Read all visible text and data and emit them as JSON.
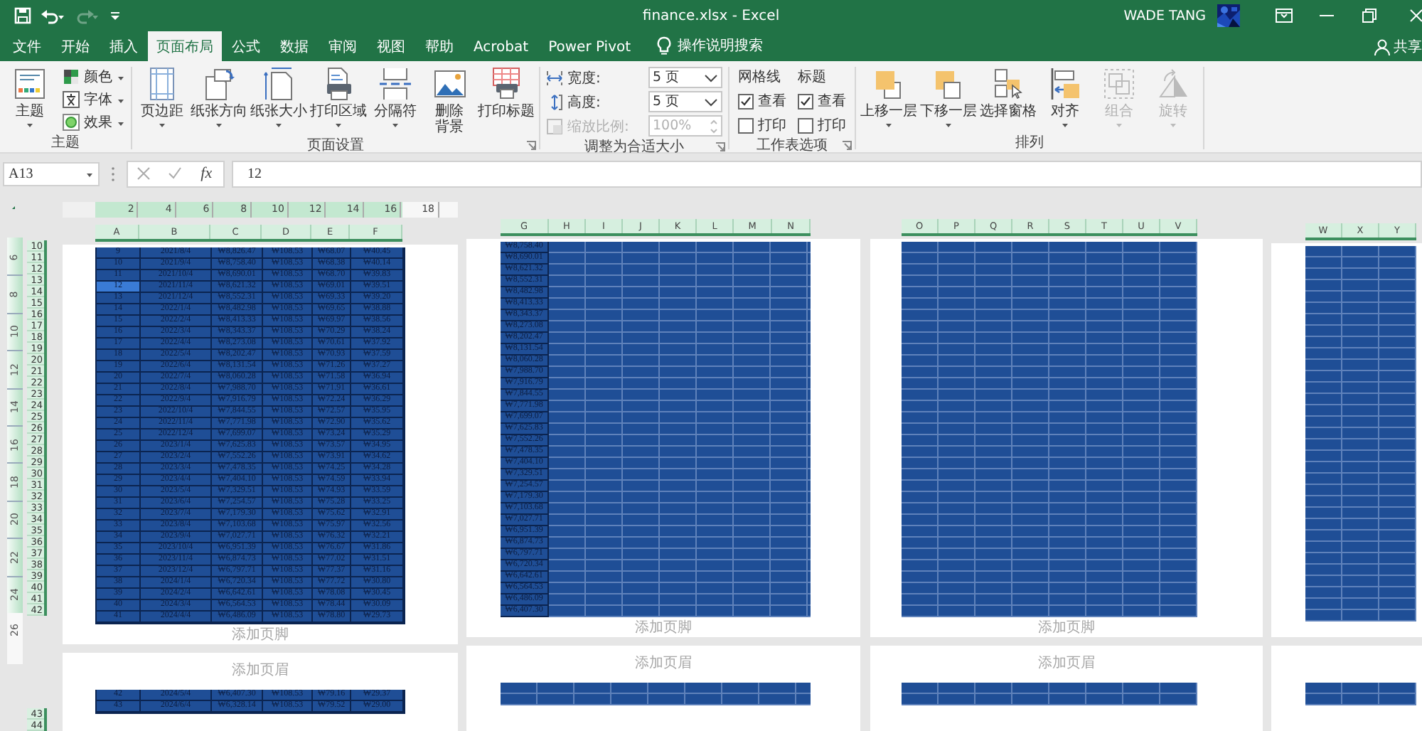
{
  "title_bar": {
    "title": "finance.xlsx  -  Excel",
    "user": "WADE TANG"
  },
  "ribbon_tabs": [
    {
      "label": "文件",
      "selected": false
    },
    {
      "label": "开始",
      "selected": false
    },
    {
      "label": "插入",
      "selected": false
    },
    {
      "label": "页面布局",
      "selected": true
    },
    {
      "label": "公式",
      "selected": false
    },
    {
      "label": "数据",
      "selected": false
    },
    {
      "label": "审阅",
      "selected": false
    },
    {
      "label": "视图",
      "selected": false
    },
    {
      "label": "帮助",
      "selected": false
    },
    {
      "label": "Acrobat",
      "selected": false
    },
    {
      "label": "Power Pivot",
      "selected": false
    }
  ],
  "tell_me": "操作说明搜索",
  "share": "共享",
  "ribbon_groups": [
    {
      "label": "主题",
      "launcher": false,
      "items": [
        {
          "kind": "big",
          "label": "主题",
          "menu": true
        },
        {
          "kind": "small",
          "label": "颜色",
          "menu": true
        },
        {
          "kind": "small",
          "label": "字体",
          "menu": true
        },
        {
          "kind": "small",
          "label": "效果",
          "menu": true
        }
      ]
    },
    {
      "label": "页面设置",
      "launcher": true,
      "items": [
        {
          "kind": "big",
          "label": "页边距",
          "menu": true
        },
        {
          "kind": "big",
          "label": "纸张方向",
          "menu": true
        },
        {
          "kind": "big",
          "label": "纸张大小",
          "menu": true
        },
        {
          "kind": "big",
          "label": "打印区域",
          "menu": true
        },
        {
          "kind": "big",
          "label": "分隔符",
          "menu": true
        },
        {
          "kind": "big",
          "lines": [
            "删除",
            "背景"
          ],
          "menu": false
        },
        {
          "kind": "big",
          "label": "打印标题",
          "menu": false
        }
      ]
    },
    {
      "label": "调整为合适大小",
      "launcher": true,
      "items": [
        {
          "kind": "dropdown",
          "label": "宽度:",
          "value": "5 页",
          "disabled": false
        },
        {
          "kind": "dropdown",
          "label": "高度:",
          "value": "5 页",
          "disabled": false
        },
        {
          "kind": "spinner",
          "label": "缩放比例:",
          "value": "100%",
          "disabled": true
        }
      ]
    },
    {
      "label": "工作表选项",
      "launcher": true,
      "items": [
        {
          "kind": "options",
          "label": "网格线",
          "options": [
            {
              "label": "查看",
              "checked": true
            },
            {
              "label": "打印",
              "checked": false
            }
          ]
        },
        {
          "kind": "options",
          "label": "标题",
          "options": [
            {
              "label": "查看",
              "checked": true
            },
            {
              "label": "打印",
              "checked": false
            }
          ]
        }
      ]
    },
    {
      "label": "排列",
      "launcher": false,
      "items": [
        {
          "kind": "big",
          "label": "上移一层",
          "menu": true,
          "disabled": false
        },
        {
          "kind": "big",
          "label": "下移一层",
          "menu": true,
          "disabled": false
        },
        {
          "kind": "big",
          "label": "选择窗格",
          "menu": false,
          "disabled": false
        },
        {
          "kind": "big",
          "label": "对齐",
          "menu": true,
          "disabled": false
        },
        {
          "kind": "big",
          "label": "组合",
          "menu": true,
          "disabled": true
        },
        {
          "kind": "big",
          "label": "旋转",
          "menu": true,
          "disabled": true
        }
      ]
    }
  ],
  "formula_bar": {
    "name_box": "A13",
    "function_button": "fx",
    "formula": "12"
  },
  "sheet_view": {
    "ruler_ticks": [
      "2",
      "4",
      "6",
      "8",
      "10",
      "12",
      "14",
      "16",
      "18"
    ],
    "vertical_ruler_ticks": [
      "6",
      "8",
      "10",
      "12",
      "14",
      "16",
      "18",
      "20",
      "22",
      "24"
    ],
    "vertical_ruler_page_end": "26",
    "row_headers": [
      "10",
      "11",
      "12",
      "13",
      "14",
      "15",
      "16",
      "17",
      "18",
      "19",
      "20",
      "21",
      "22",
      "23",
      "24",
      "25",
      "26",
      "27",
      "28",
      "29",
      "30",
      "31",
      "32",
      "33",
      "34",
      "35",
      "36",
      "37",
      "38",
      "39",
      "40",
      "41",
      "42"
    ],
    "pages": [
      {
        "columns": [
          "A",
          "B",
          "C",
          "D",
          "E",
          "F"
        ],
        "footer": "添加页脚",
        "rows": [
          {
            "cells": [
              "9",
              "2021/8/4",
              "₩8,826.47",
              "₩108.53",
              "₩68.07",
              "₩40.45"
            ],
            "selected": false
          },
          {
            "cells": [
              "10",
              "2021/9/4",
              "₩8,758.40",
              "₩108.53",
              "₩68.38",
              "₩40.14"
            ],
            "selected": false
          },
          {
            "cells": [
              "11",
              "2021/10/4",
              "₩8,690.01",
              "₩108.53",
              "₩68.70",
              "₩39.83"
            ],
            "selected": false
          },
          {
            "cells": [
              "12",
              "2021/11/4",
              "₩8,621.32",
              "₩108.53",
              "₩69.01",
              "₩39.51"
            ],
            "selected": true
          },
          {
            "cells": [
              "13",
              "2021/12/4",
              "₩8,552.31",
              "₩108.53",
              "₩69.33",
              "₩39.20"
            ],
            "selected": false
          },
          {
            "cells": [
              "14",
              "2022/1/4",
              "₩8,482.98",
              "₩108.53",
              "₩69.65",
              "₩38.88"
            ],
            "selected": false
          },
          {
            "cells": [
              "15",
              "2022/2/4",
              "₩8,413.33",
              "₩108.53",
              "₩69.97",
              "₩38.56"
            ],
            "selected": false
          },
          {
            "cells": [
              "16",
              "2022/3/4",
              "₩8,343.37",
              "₩108.53",
              "₩70.29",
              "₩38.24"
            ],
            "selected": false
          },
          {
            "cells": [
              "17",
              "2022/4/4",
              "₩8,273.08",
              "₩108.53",
              "₩70.61",
              "₩37.92"
            ],
            "selected": false
          },
          {
            "cells": [
              "18",
              "2022/5/4",
              "₩8,202.47",
              "₩108.53",
              "₩70.93",
              "₩37.59"
            ],
            "selected": false
          },
          {
            "cells": [
              "19",
              "2022/6/4",
              "₩8,131.54",
              "₩108.53",
              "₩71.26",
              "₩37.27"
            ],
            "selected": false
          },
          {
            "cells": [
              "20",
              "2022/7/4",
              "₩8,060.28",
              "₩108.53",
              "₩71.58",
              "₩36.94"
            ],
            "selected": false
          },
          {
            "cells": [
              "21",
              "2022/8/4",
              "₩7,988.70",
              "₩108.53",
              "₩71.91",
              "₩36.61"
            ],
            "selected": false
          },
          {
            "cells": [
              "22",
              "2022/9/4",
              "₩7,916.79",
              "₩108.53",
              "₩72.24",
              "₩36.29"
            ],
            "selected": false
          },
          {
            "cells": [
              "23",
              "2022/10/4",
              "₩7,844.55",
              "₩108.53",
              "₩72.57",
              "₩35.95"
            ],
            "selected": false
          },
          {
            "cells": [
              "24",
              "2022/11/4",
              "₩7,771.98",
              "₩108.53",
              "₩72.90",
              "₩35.62"
            ],
            "selected": false
          },
          {
            "cells": [
              "25",
              "2022/12/4",
              "₩7,699.07",
              "₩108.53",
              "₩73.24",
              "₩35.29"
            ],
            "selected": false
          },
          {
            "cells": [
              "26",
              "2023/1/4",
              "₩7,625.83",
              "₩108.53",
              "₩73.57",
              "₩34.95"
            ],
            "selected": false
          },
          {
            "cells": [
              "27",
              "2023/2/4",
              "₩7,552.26",
              "₩108.53",
              "₩73.91",
              "₩34.62"
            ],
            "selected": false
          },
          {
            "cells": [
              "28",
              "2023/3/4",
              "₩7,478.35",
              "₩108.53",
              "₩74.25",
              "₩34.28"
            ],
            "selected": false
          },
          {
            "cells": [
              "29",
              "2023/4/4",
              "₩7,404.10",
              "₩108.53",
              "₩74.59",
              "₩33.94"
            ],
            "selected": false
          },
          {
            "cells": [
              "30",
              "2023/5/4",
              "₩7,329.51",
              "₩108.53",
              "₩74.93",
              "₩33.59"
            ],
            "selected": false
          },
          {
            "cells": [
              "31",
              "2023/6/4",
              "₩7,254.57",
              "₩108.53",
              "₩75.28",
              "₩33.25"
            ],
            "selected": false
          },
          {
            "cells": [
              "32",
              "2023/7/4",
              "₩7,179.30",
              "₩108.53",
              "₩75.62",
              "₩32.91"
            ],
            "selected": false
          },
          {
            "cells": [
              "33",
              "2023/8/4",
              "₩7,103.68",
              "₩108.53",
              "₩75.97",
              "₩32.56"
            ],
            "selected": false
          },
          {
            "cells": [
              "34",
              "2023/9/4",
              "₩7,027.71",
              "₩108.53",
              "₩76.32",
              "₩32.21"
            ],
            "selected": false
          },
          {
            "cells": [
              "35",
              "2023/10/4",
              "₩6,951.39",
              "₩108.53",
              "₩76.67",
              "₩31.86"
            ],
            "selected": false
          },
          {
            "cells": [
              "36",
              "2023/11/4",
              "₩6,874.73",
              "₩108.53",
              "₩77.02",
              "₩31.51"
            ],
            "selected": false
          },
          {
            "cells": [
              "37",
              "2023/12/4",
              "₩6,797.71",
              "₩108.53",
              "₩77.37",
              "₩31.16"
            ],
            "selected": false
          },
          {
            "cells": [
              "38",
              "2024/1/4",
              "₩6,720.34",
              "₩108.53",
              "₩77.72",
              "₩30.80"
            ],
            "selected": false
          },
          {
            "cells": [
              "39",
              "2024/2/4",
              "₩6,642.61",
              "₩108.53",
              "₩78.08",
              "₩30.45"
            ],
            "selected": false
          },
          {
            "cells": [
              "40",
              "2024/3/4",
              "₩6,564.53",
              "₩108.53",
              "₩78.44",
              "₩30.09"
            ],
            "selected": false
          },
          {
            "cells": [
              "41",
              "2024/4/4",
              "₩6,486.09",
              "₩108.53",
              "₩78.80",
              "₩29.73"
            ],
            "selected": false
          }
        ]
      },
      {
        "columns": [
          "G",
          "H",
          "I",
          "J",
          "K",
          "L",
          "M",
          "N"
        ],
        "footer": "添加页脚",
        "rows": [
          {
            "cells": [
              "₩8,758.40"
            ]
          },
          {
            "cells": [
              "₩8,690.01"
            ]
          },
          {
            "cells": [
              "₩8,621.32"
            ]
          },
          {
            "cells": [
              "₩8,552.31"
            ]
          },
          {
            "cells": [
              "₩8,482.98"
            ]
          },
          {
            "cells": [
              "₩8,413.33"
            ]
          },
          {
            "cells": [
              "₩8,343.37"
            ]
          },
          {
            "cells": [
              "₩8,273.08"
            ]
          },
          {
            "cells": [
              "₩8,202.47"
            ]
          },
          {
            "cells": [
              "₩8,131.54"
            ]
          },
          {
            "cells": [
              "₩8,060.28"
            ]
          },
          {
            "cells": [
              "₩7,988.70"
            ]
          },
          {
            "cells": [
              "₩7,916.79"
            ]
          },
          {
            "cells": [
              "₩7,844.55"
            ]
          },
          {
            "cells": [
              "₩7,771.98"
            ]
          },
          {
            "cells": [
              "₩7,699.07"
            ]
          },
          {
            "cells": [
              "₩7,625.83"
            ]
          },
          {
            "cells": [
              "₩7,552.26"
            ]
          },
          {
            "cells": [
              "₩7,478.35"
            ]
          },
          {
            "cells": [
              "₩7,404.10"
            ]
          },
          {
            "cells": [
              "₩7,329.51"
            ]
          },
          {
            "cells": [
              "₩7,254.57"
            ]
          },
          {
            "cells": [
              "₩7,179.30"
            ]
          },
          {
            "cells": [
              "₩7,103.68"
            ]
          },
          {
            "cells": [
              "₩7,027.71"
            ]
          },
          {
            "cells": [
              "₩6,951.39"
            ]
          },
          {
            "cells": [
              "₩6,874.73"
            ]
          },
          {
            "cells": [
              "₩6,797.71"
            ]
          },
          {
            "cells": [
              "₩6,720.34"
            ]
          },
          {
            "cells": [
              "₩6,642.61"
            ]
          },
          {
            "cells": [
              "₩6,564.53"
            ]
          },
          {
            "cells": [
              "₩6,486.09"
            ]
          },
          {
            "cells": [
              "₩6,407.30"
            ]
          }
        ]
      },
      {
        "columns": [
          "O",
          "P",
          "Q",
          "R",
          "S",
          "T",
          "U",
          "V"
        ],
        "footer": "添加页脚"
      },
      {
        "columns": [
          "W",
          "X",
          "Y"
        ]
      }
    ],
    "lower_row_headers": [
      "43",
      "44"
    ],
    "lower_pages": [
      {
        "header": "添加页眉",
        "rows": [
          {
            "cells": [
              "42",
              "2024/5/4",
              "₩6,407.30",
              "₩108.53",
              "₩79.16",
              "₩29.37"
            ]
          },
          {
            "cells": [
              "43",
              "2024/6/4",
              "₩6,328.14",
              "₩108.53",
              "₩79.52",
              "₩29.00"
            ]
          }
        ]
      },
      {
        "header": "添加页眉"
      },
      {
        "header": "添加页眉"
      }
    ]
  }
}
